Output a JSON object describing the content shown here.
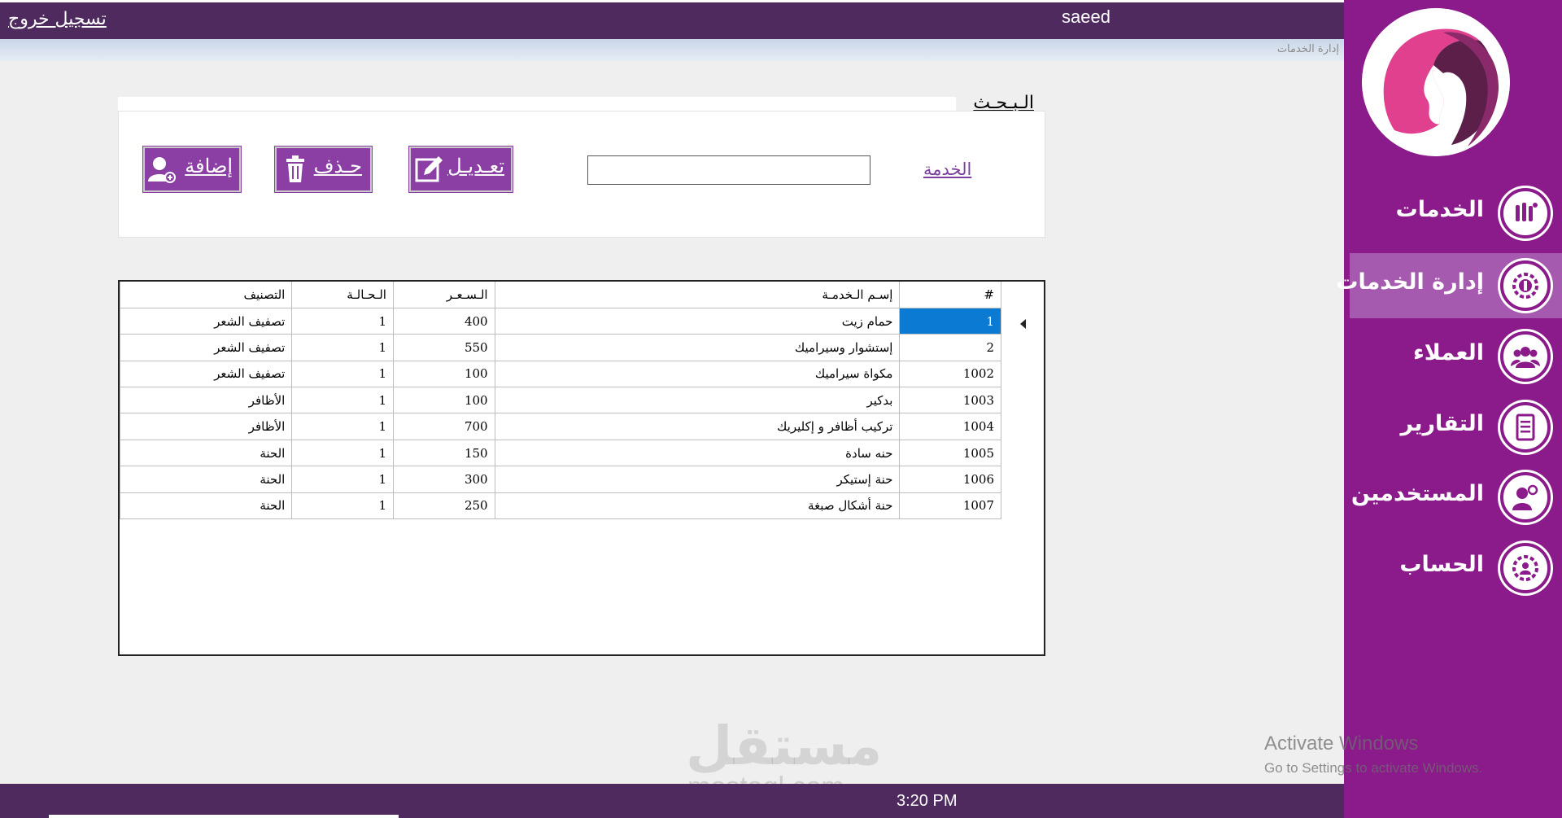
{
  "header": {
    "logout_label": "تسجيل خروج",
    "username": "saeed",
    "breadcrumb": "إدارة الخدمات"
  },
  "sidebar": {
    "items": [
      {
        "label": "الخدمات",
        "icon": "makeup-brushes-icon",
        "active": false
      },
      {
        "label": "إدارة الخدمات",
        "icon": "gear-brush-icon",
        "active": true
      },
      {
        "label": "العملاء",
        "icon": "customers-group-icon",
        "active": false
      },
      {
        "label": "التقارير",
        "icon": "report-document-icon",
        "active": false
      },
      {
        "label": "المستخدمين",
        "icon": "users-icon",
        "active": false
      },
      {
        "label": "الحساب",
        "icon": "account-gear-icon",
        "active": false
      }
    ]
  },
  "search": {
    "title": "الـبـحـث",
    "field_label": "الخدمة",
    "value": "",
    "placeholder": ""
  },
  "actions": {
    "edit_label": "تعـديـل",
    "delete_label": "حـذف",
    "add_label": "إضافة"
  },
  "table": {
    "columns": [
      "#",
      "إسـم الـخدمـة",
      "الـسـعـر",
      "الـحـالـة",
      "التصنيف"
    ],
    "rows": [
      [
        "1",
        "حمام زيت",
        "400",
        "1",
        "تصفيف الشعر"
      ],
      [
        "2",
        "إستشوار وسيراميك",
        "550",
        "1",
        "تصفيف الشعر"
      ],
      [
        "1002",
        "مكواة سيراميك",
        "100",
        "1",
        "تصفيف الشعر"
      ],
      [
        "1003",
        "بدكير",
        "100",
        "1",
        "الأظافر"
      ],
      [
        "1004",
        "تركيب أظافر و إكليريك",
        "700",
        "1",
        "الأظافر"
      ],
      [
        "1005",
        "حنه سادة",
        "150",
        "1",
        "الحنة"
      ],
      [
        "1006",
        "حنة إستيكر",
        "300",
        "1",
        "الحنة"
      ],
      [
        "1007",
        "حنة أشكال صبغة",
        "250",
        "1",
        "الحنة"
      ]
    ]
  },
  "footer": {
    "time": "3:20 PM"
  },
  "watermark": {
    "arabic": "مستقل",
    "latin": "mostaql.com"
  },
  "windows_notice": {
    "title": "Activate Windows",
    "subtitle": "Go to Settings to activate Windows."
  },
  "colors": {
    "sidebar": "#8b1a8b",
    "topbar": "#4e2a5f",
    "button": "#8b3fa5",
    "selection": "#0b7ad3"
  }
}
